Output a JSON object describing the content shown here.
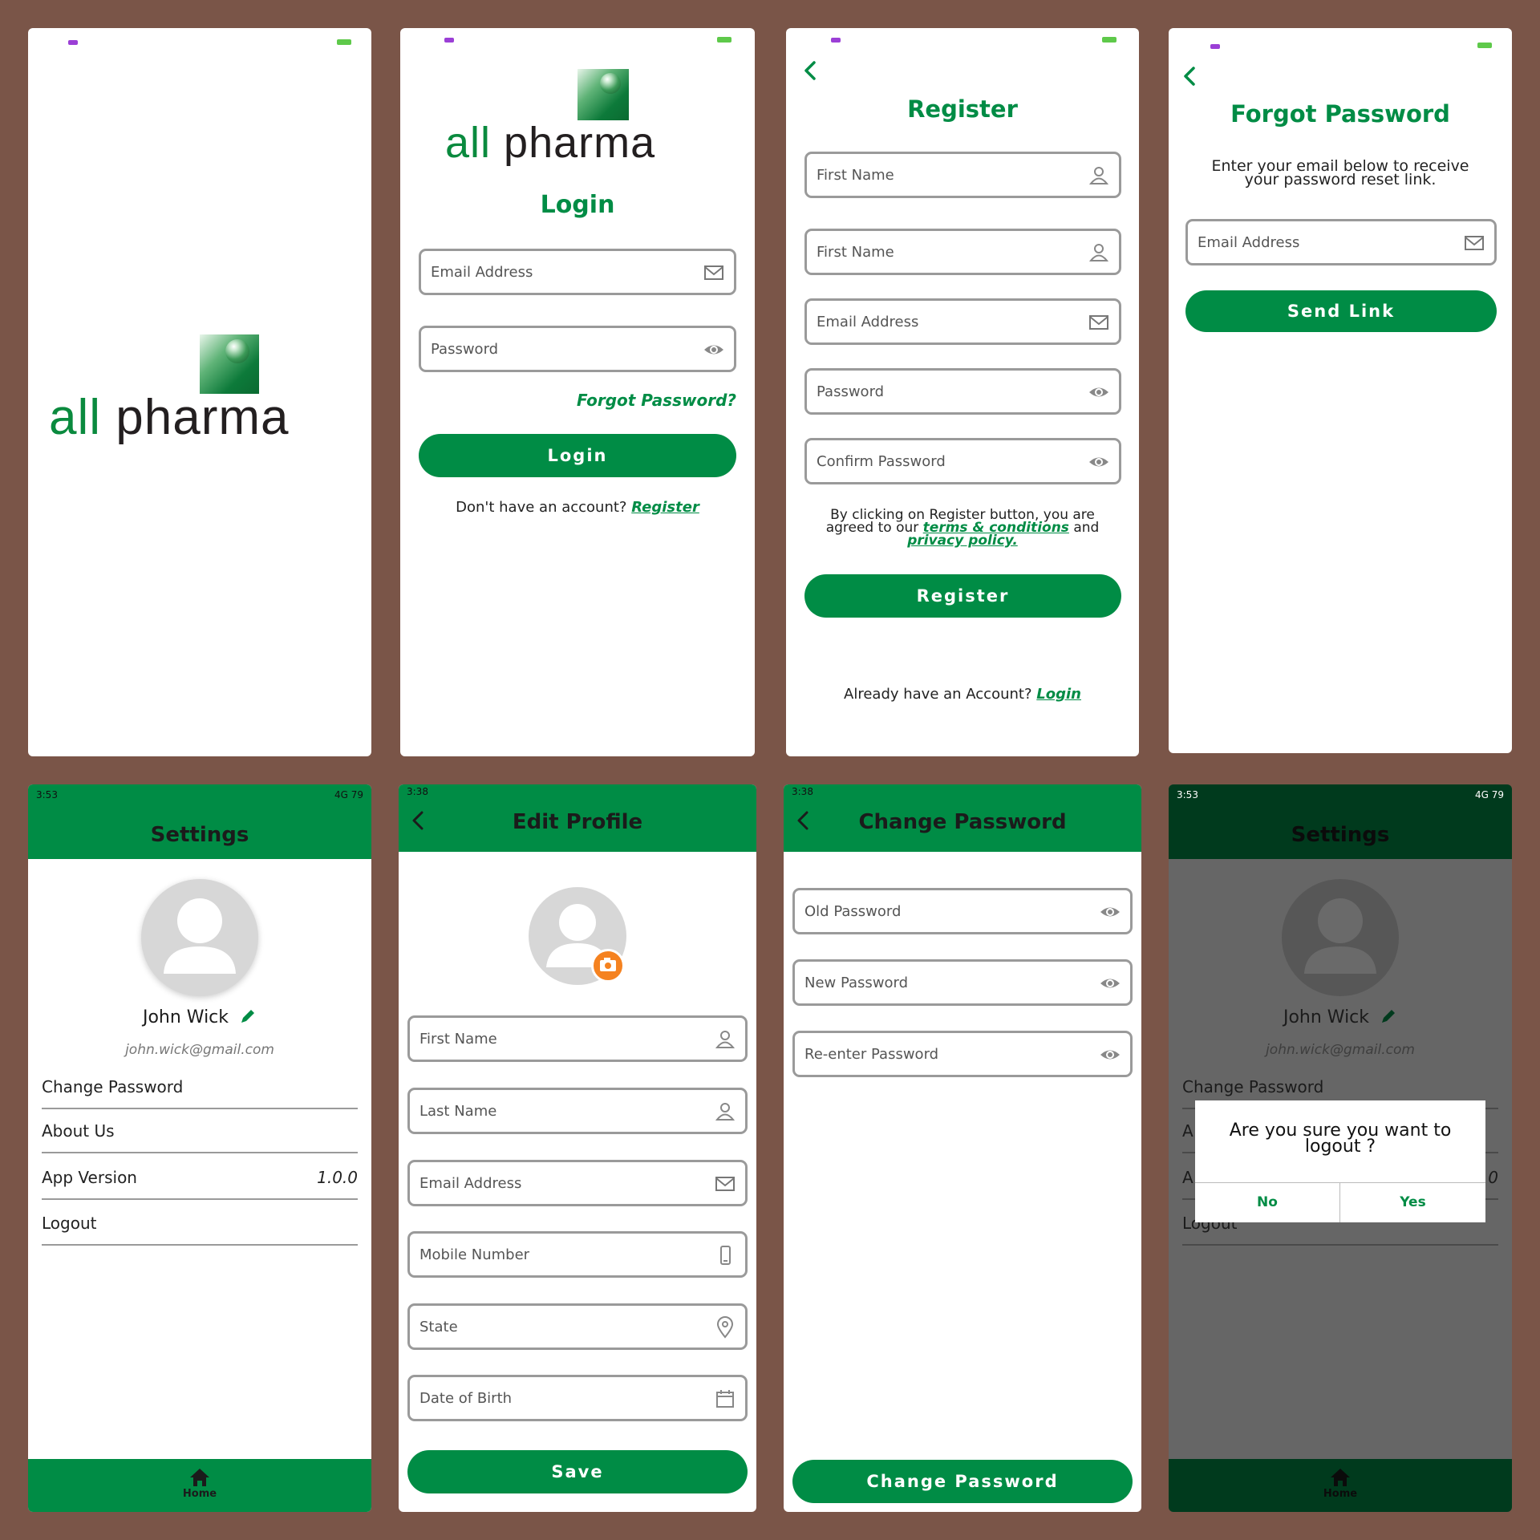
{
  "brand": {
    "word1": "all",
    "word2": "pharma"
  },
  "login": {
    "title": "Login",
    "email_placeholder": "Email Address",
    "password_placeholder": "Password",
    "forgot": "Forgot Password?",
    "button": "Login",
    "no_account": "Don't have an account?",
    "register_link": "Register"
  },
  "register": {
    "title": "Register",
    "fields": [
      "First Name",
      "First Name",
      "Email Address",
      "Password",
      "Confirm Password"
    ],
    "terms_line1": "By clicking on Register button, you are",
    "terms_line2a": "agreed to our",
    "terms_link": "terms & conditions",
    "terms_and": "and",
    "privacy_link": "privacy policy.",
    "button": "Register",
    "have_account": "Already have an Account?",
    "login_link": "Login"
  },
  "forgot": {
    "title": "Forgot Password",
    "desc_line1": "Enter your email below to receive",
    "desc_line2": "your password reset link.",
    "email_placeholder": "Email Address",
    "button": "Send Link"
  },
  "settings": {
    "status_time": "3:53",
    "status_net": "4G",
    "status_battery": "79",
    "title": "Settings",
    "name": "John Wick",
    "email": "john.wick@gmail.com",
    "items": [
      {
        "label": "Change Password",
        "value": ""
      },
      {
        "label": "About Us",
        "value": ""
      },
      {
        "label": "App Version",
        "value": "1.0.0"
      },
      {
        "label": "Logout",
        "value": ""
      }
    ],
    "nav_home": "Home"
  },
  "edit_profile": {
    "status_time": "3:38",
    "title": "Edit Profile",
    "fields": [
      "First Name",
      "Last Name",
      "Email Address",
      "Mobile Number",
      "State",
      "Date of Birth"
    ],
    "button": "Save"
  },
  "change_password": {
    "status_time": "3:38",
    "title": "Change Password",
    "fields": [
      "Old Password",
      "New Password",
      "Re-enter Password"
    ],
    "button": "Change Password"
  },
  "logout_dialog": {
    "message_line1": "Are you sure you want to",
    "message_line2": "logout ?",
    "no": "No",
    "yes": "Yes",
    "behind_items": [
      "Change Password",
      "A",
      "A",
      "Logout"
    ],
    "behind_value": "0"
  },
  "colors": {
    "accent": "#008c45",
    "background": "#7a5548",
    "dialog_overlay": "#666666"
  }
}
